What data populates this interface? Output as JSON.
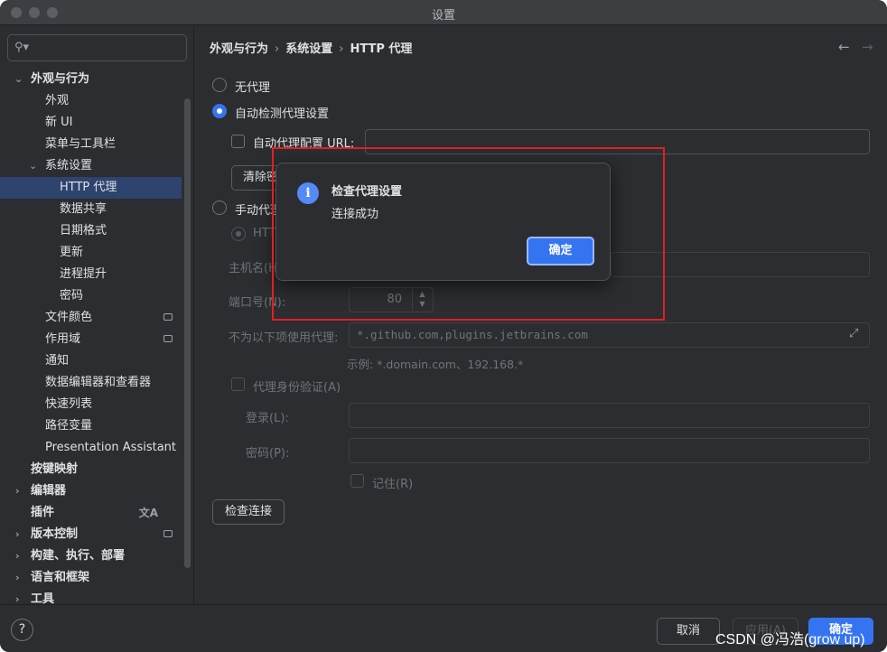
{
  "window": {
    "title": "设置"
  },
  "search": {
    "placeholder": ""
  },
  "sidebar": {
    "items": [
      {
        "label": "外观与行为",
        "level": 0,
        "expanded": true
      },
      {
        "label": "外观",
        "level": 1
      },
      {
        "label": "新 UI",
        "level": 1
      },
      {
        "label": "菜单与工具栏",
        "level": 1
      },
      {
        "label": "系统设置",
        "level": 1,
        "expanded": true
      },
      {
        "label": "HTTP 代理",
        "level": 2,
        "selected": true
      },
      {
        "label": "数据共享",
        "level": 2
      },
      {
        "label": "日期格式",
        "level": 2
      },
      {
        "label": "更新",
        "level": 2
      },
      {
        "label": "进程提升",
        "level": 2
      },
      {
        "label": "密码",
        "level": 2
      },
      {
        "label": "文件颜色",
        "level": 1
      },
      {
        "label": "作用域",
        "level": 1
      },
      {
        "label": "通知",
        "level": 1
      },
      {
        "label": "数据编辑器和查看器",
        "level": 1
      },
      {
        "label": "快速列表",
        "level": 1
      },
      {
        "label": "路径变量",
        "level": 1
      },
      {
        "label": "Presentation Assistant",
        "level": 1
      },
      {
        "label": "按键映射",
        "level": 0
      },
      {
        "label": "编辑器",
        "level": 0,
        "collapsed": true
      },
      {
        "label": "插件",
        "level": 0
      },
      {
        "label": "版本控制",
        "level": 0,
        "collapsed": true
      },
      {
        "label": "构建、执行、部署",
        "level": 0,
        "collapsed": true
      },
      {
        "label": "语言和框架",
        "level": 0,
        "collapsed": true
      },
      {
        "label": "工具",
        "level": 0,
        "collapsed": true
      }
    ]
  },
  "breadcrumb": {
    "part1": "外观与行为",
    "part2": "系统设置",
    "part3": "HTTP 代理",
    "sep": "›"
  },
  "proxy": {
    "no_proxy": "无代理",
    "auto_detect": "自动检测代理设置",
    "auto_config_url": "自动代理配置 URL:",
    "auto_config_url_value": "",
    "clear_button": "清除密",
    "manual": "手动代理",
    "http": "HTTP",
    "host_label": "主机名(H",
    "port_label": "端口号(N):",
    "port_value": "80",
    "no_proxy_for_label": "不为以下项使用代理:",
    "no_proxy_for_value": "*.github.com,plugins.jetbrains.com",
    "example": "示例: *.domain.com、192.168.*",
    "auth_label": "代理身份验证(A)",
    "login_label": "登录(L):",
    "password_label": "密码(P):",
    "remember_label": "记住(R)",
    "check_button": "检查连接"
  },
  "dialog": {
    "title": "检查代理设置",
    "message": "连接成功",
    "ok": "确定"
  },
  "footer": {
    "help": "?",
    "cancel": "取消",
    "apply": "应用(A)",
    "ok": "确定"
  },
  "watermark": "CSDN @冯浩(grow up)",
  "colors": {
    "accent": "#3574f0",
    "background": "#2b2d30",
    "highlight": "#e02020"
  }
}
